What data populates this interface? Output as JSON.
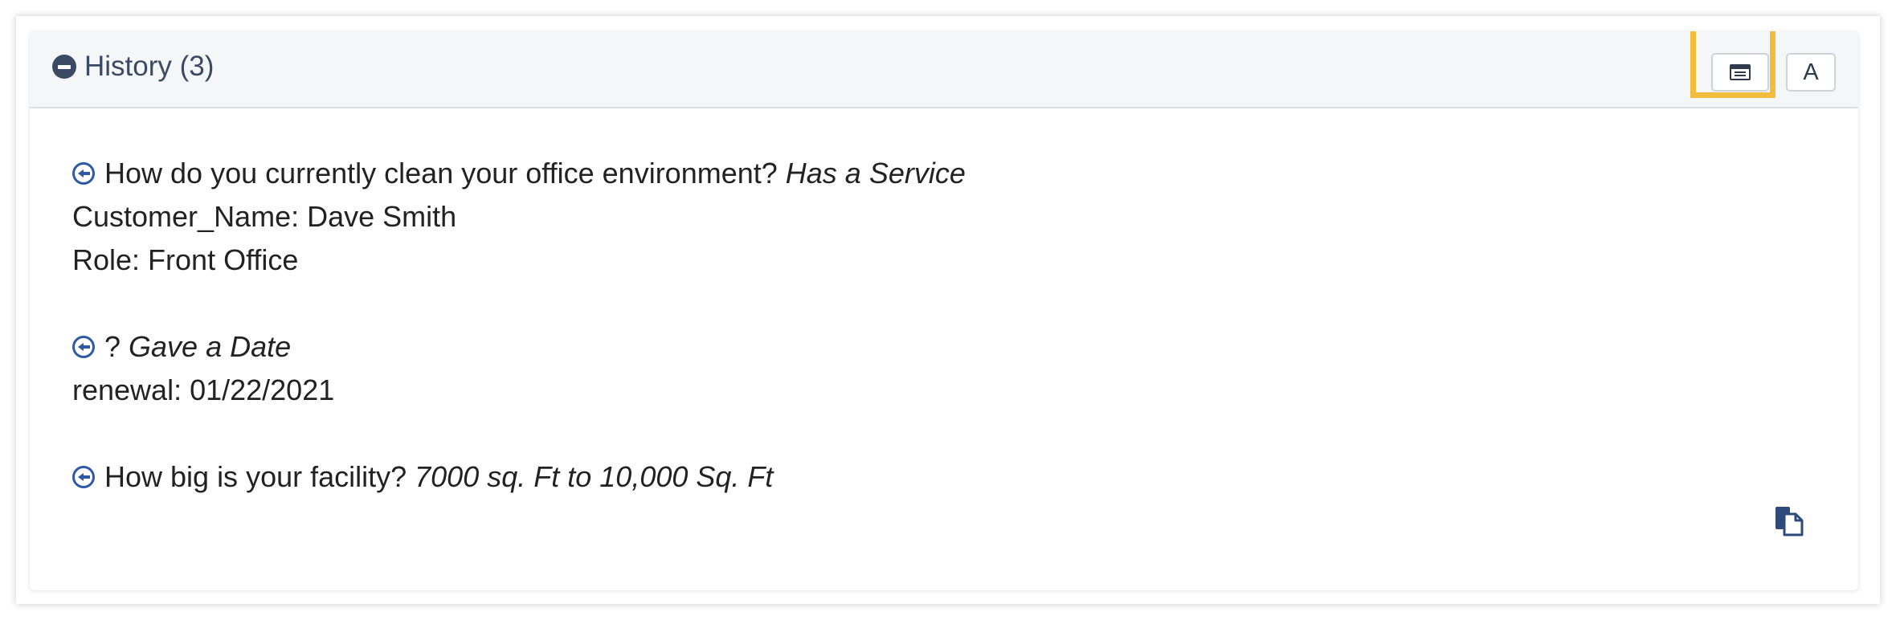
{
  "history": {
    "title": "History (3)",
    "toolbar": {
      "view_icon": "list-view-icon",
      "a_label": "A"
    },
    "entries": [
      {
        "question": "How do you currently clean your office environment?",
        "answer": "Has a Service",
        "fields": [
          "Customer_Name: Dave Smith",
          "Role: Front Office"
        ]
      },
      {
        "question": "?",
        "answer": "Gave a Date",
        "fields": [
          "renewal: 01/22/2021"
        ]
      },
      {
        "question": "How big is your facility?",
        "answer": "7000 sq. Ft to 10,000 Sq. Ft",
        "fields": []
      }
    ],
    "copy_icon": "copy-icon"
  },
  "colors": {
    "header_bg": "#f5f6f7",
    "title_text": "#3b4a63",
    "highlight": "#f2bc3c",
    "link_icon": "#2f59a6"
  }
}
